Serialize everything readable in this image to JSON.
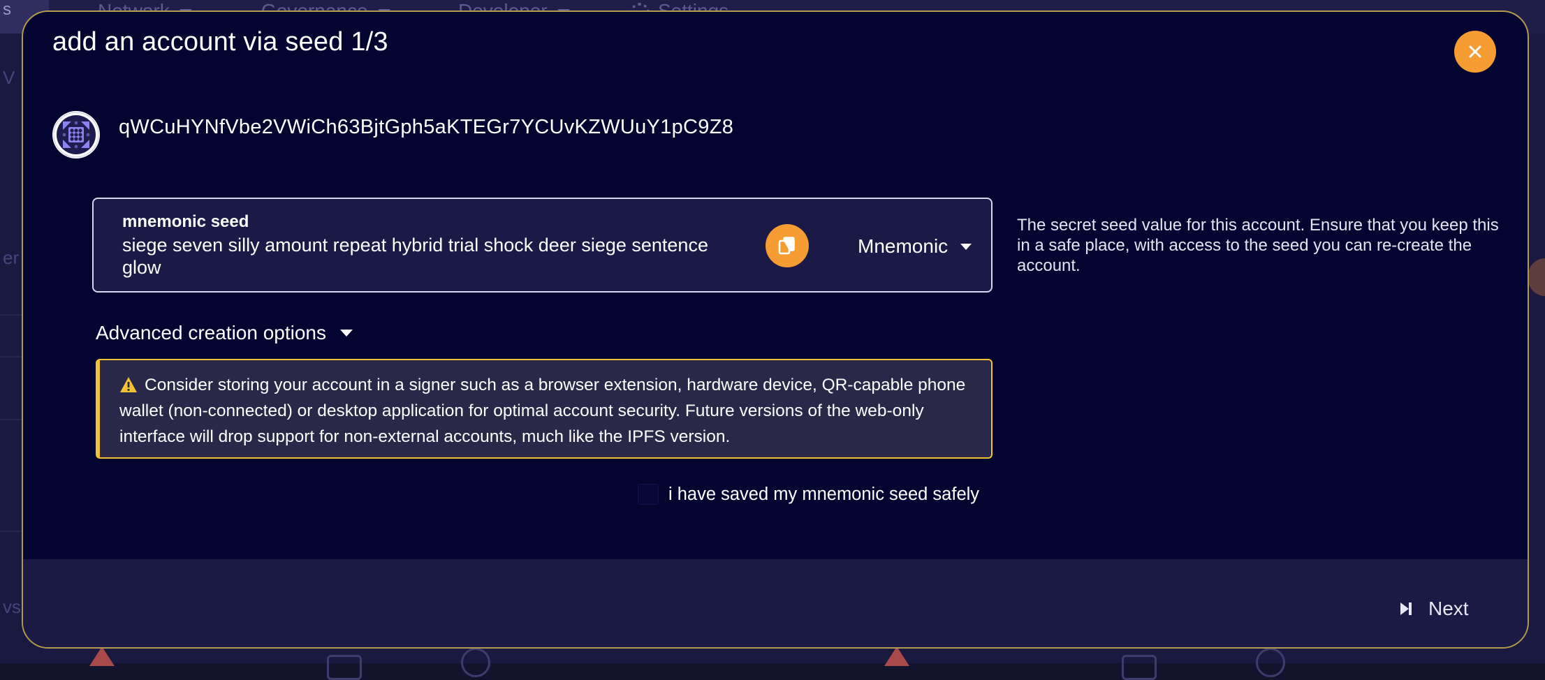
{
  "background": {
    "tag_left": "s",
    "menu": [
      {
        "label": "Network"
      },
      {
        "label": "Governance"
      },
      {
        "label": "Developer"
      },
      {
        "label": "Settings"
      }
    ],
    "side_texts": [
      "V",
      "er I",
      "vs"
    ]
  },
  "modal": {
    "title": "add an account via seed 1/3",
    "close_icon": "close-icon"
  },
  "account": {
    "avatar_icon": "identicon",
    "address": "qWCuHYNfVbe2VWiCh63BjtGph5aKTEGr7YCUvKZWUuY1pC9Z8"
  },
  "seed": {
    "label": "mnemonic seed",
    "value": "siege seven silly amount repeat hybrid trial shock deer siege sentence glow",
    "copy_icon": "copy-icon",
    "type_selected": "Mnemonic",
    "help": "The secret seed value for this account. Ensure that you keep this in a safe place, with access to the seed you can re-create the account."
  },
  "advanced": {
    "label": "Advanced creation options"
  },
  "warning": {
    "icon": "warning-icon",
    "text": "Consider storing your account in a signer such as a browser extension, hardware device, QR-capable phone wallet (non-connected) or desktop application for optimal account security. Future versions of the web-only interface will drop support for non-external accounts, much like the IPFS version."
  },
  "confirm": {
    "checked": false,
    "label": "i have saved my mnemonic seed safely"
  },
  "footer": {
    "next_label": "Next",
    "next_icon": "step-forward-icon"
  },
  "colors": {
    "accent": "#f59d32",
    "modal_bg": "#040430",
    "footer_bg": "#1b1a44",
    "warning_border": "#f2c232",
    "modal_border": "#b49a4c"
  }
}
